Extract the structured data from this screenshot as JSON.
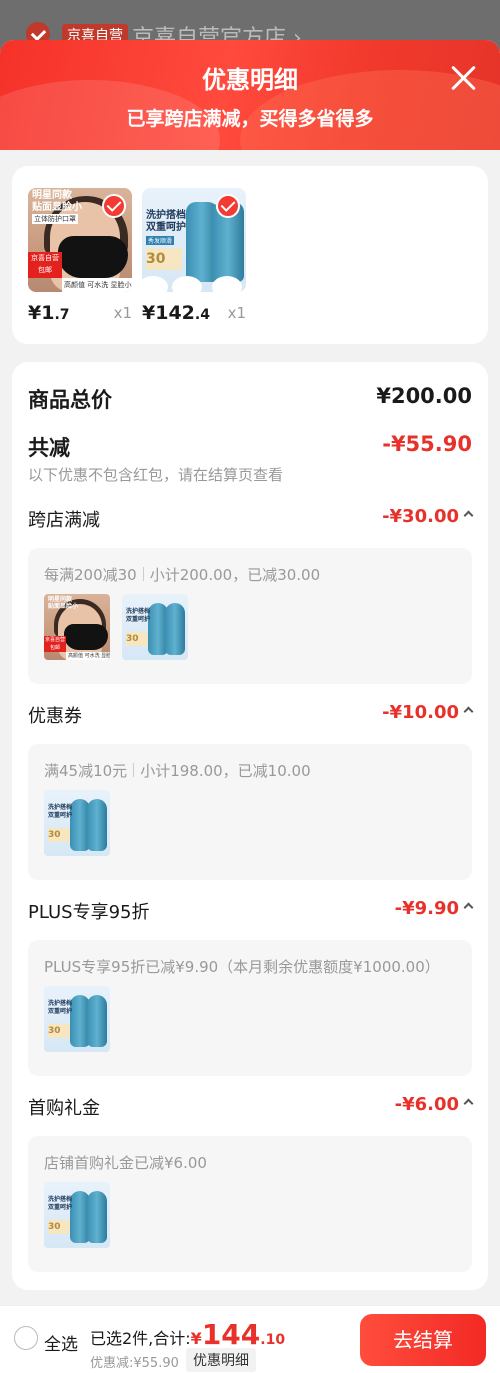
{
  "background": {
    "badge": "京喜自营",
    "shop_name": "京喜自营官方店 ›"
  },
  "header": {
    "title": "优惠明细",
    "subtitle": "已享跨店满减，买得多省得多"
  },
  "products": [
    {
      "price_int": "¥1",
      "price_dec": ".7",
      "qty": "x1",
      "image_text": {
        "tag1": "明星同款\n贴面显脸小",
        "tag2": "立体防护口罩",
        "tag3": "京喜自营\n包邮",
        "tag4": "高颜值 可水洗 显脸小"
      }
    },
    {
      "price_int": "¥142",
      "price_dec": ".4",
      "qty": "x1",
      "image_text": {
        "t1": "洗护搭档\n双重呵护",
        "t2": "秀发顺滑",
        "t3": "30"
      }
    }
  ],
  "summary": {
    "total_label": "商品总价",
    "total_value": "¥200.00",
    "reduce_label": "共减",
    "reduce_value": "-¥55.90",
    "note": "以下优惠不包含红包，请在结算页查看"
  },
  "promotions": [
    {
      "name": "跨店满减",
      "amount": "-¥30.00",
      "desc_a": "每满200减30",
      "desc_b": "小计200.00，已减30.00"
    },
    {
      "name": "优惠券",
      "amount": "-¥10.00",
      "desc_a": "满45减10元",
      "desc_b": "小计198.00，已减10.00"
    },
    {
      "name": "PLUS专享95折",
      "amount": "-¥9.90",
      "desc_a": "PLUS专享95折已减¥9.90（本月剩余优惠额度¥1000.00）",
      "desc_b": ""
    },
    {
      "name": "首购礼金",
      "amount": "-¥6.00",
      "desc_a": "店铺首购礼金已减¥6.00",
      "desc_b": ""
    }
  ],
  "bottom_bar": {
    "select_all": "全选",
    "selected_text": "已选2件,合计:",
    "total_yen": "¥",
    "total_int": "144",
    "total_dec": ".10",
    "discount_text": "优惠减:¥55.90",
    "detail_label": "优惠明细",
    "checkout_label": "去结算"
  },
  "colors": {
    "accent": "#e8312b",
    "header_red": "#f5322a"
  }
}
